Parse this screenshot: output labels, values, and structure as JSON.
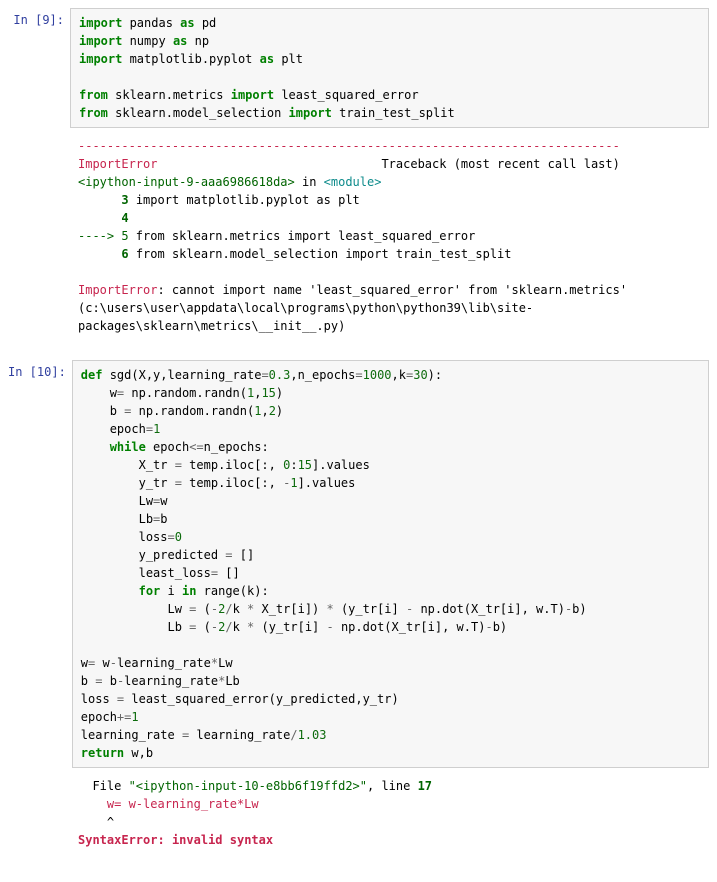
{
  "cells": [
    {
      "prompt": "In [9]:",
      "input_lines": [
        [
          {
            "cls": "kw",
            "t": "import"
          },
          {
            "cls": "nm",
            "t": " pandas "
          },
          {
            "cls": "kw",
            "t": "as"
          },
          {
            "cls": "nm",
            "t": " pd"
          }
        ],
        [
          {
            "cls": "kw",
            "t": "import"
          },
          {
            "cls": "nm",
            "t": " numpy "
          },
          {
            "cls": "kw",
            "t": "as"
          },
          {
            "cls": "nm",
            "t": " np"
          }
        ],
        [
          {
            "cls": "kw",
            "t": "import"
          },
          {
            "cls": "nm",
            "t": " matplotlib.pyplot "
          },
          {
            "cls": "kw",
            "t": "as"
          },
          {
            "cls": "nm",
            "t": " plt"
          }
        ],
        [],
        [
          {
            "cls": "kw",
            "t": "from"
          },
          {
            "cls": "nm",
            "t": " sklearn.metrics "
          },
          {
            "cls": "kw",
            "t": "import"
          },
          {
            "cls": "nm",
            "t": " least_squared_error"
          }
        ],
        [
          {
            "cls": "kw",
            "t": "from"
          },
          {
            "cls": "nm",
            "t": " sklearn.model_selection "
          },
          {
            "cls": "kw",
            "t": "import"
          },
          {
            "cls": "nm",
            "t": " train_test_split"
          }
        ]
      ],
      "output_lines": [
        [
          {
            "cls": "err-red",
            "t": "---------------------------------------------------------------------------"
          }
        ],
        [
          {
            "cls": "err-red",
            "t": "ImportError"
          },
          {
            "cls": "nm",
            "t": "                               Traceback (most recent call last)"
          }
        ],
        [
          {
            "cls": "err-green",
            "t": "<ipython-input-9-aaa6986618da>"
          },
          {
            "cls": "nm",
            "t": " in "
          },
          {
            "cls": "err-cyan",
            "t": "<module>"
          }
        ],
        [
          {
            "cls": "nm",
            "t": "      "
          },
          {
            "cls": "err-green bold",
            "t": "3"
          },
          {
            "cls": "nm",
            "t": " import matplotlib.pyplot as plt"
          }
        ],
        [
          {
            "cls": "nm",
            "t": "      "
          },
          {
            "cls": "err-green bold",
            "t": "4"
          }
        ],
        [
          {
            "cls": "err-green",
            "t": "----> 5"
          },
          {
            "cls": "nm",
            "t": " from sklearn.metrics import least_squared_error"
          }
        ],
        [
          {
            "cls": "nm",
            "t": "      "
          },
          {
            "cls": "err-green bold",
            "t": "6"
          },
          {
            "cls": "nm",
            "t": " from sklearn.model_selection import train_test_split"
          }
        ],
        [],
        [
          {
            "cls": "err-red",
            "t": "ImportError"
          },
          {
            "cls": "nm",
            "t": ": cannot import name 'least_squared_error' from 'sklearn.metrics' (c:\\users\\user\\appdata\\local\\programs\\python\\python39\\lib\\site-packages\\sklearn\\metrics\\__init__.py)"
          }
        ]
      ]
    },
    {
      "prompt": "In [10]:",
      "input_lines": [
        [
          {
            "cls": "kw",
            "t": "def"
          },
          {
            "cls": "nm",
            "t": " sgd(X,y,learning_rate"
          },
          {
            "cls": "op",
            "t": "="
          },
          {
            "cls": "num",
            "t": "0.3"
          },
          {
            "cls": "nm",
            "t": ",n_epochs"
          },
          {
            "cls": "op",
            "t": "="
          },
          {
            "cls": "num",
            "t": "1000"
          },
          {
            "cls": "nm",
            "t": ",k"
          },
          {
            "cls": "op",
            "t": "="
          },
          {
            "cls": "num",
            "t": "30"
          },
          {
            "cls": "nm",
            "t": "):"
          }
        ],
        [
          {
            "cls": "nm",
            "t": "    w"
          },
          {
            "cls": "op",
            "t": "="
          },
          {
            "cls": "nm",
            "t": " np.random.randn("
          },
          {
            "cls": "num",
            "t": "1"
          },
          {
            "cls": "nm",
            "t": ","
          },
          {
            "cls": "num",
            "t": "15"
          },
          {
            "cls": "nm",
            "t": ")"
          }
        ],
        [
          {
            "cls": "nm",
            "t": "    b "
          },
          {
            "cls": "op",
            "t": "="
          },
          {
            "cls": "nm",
            "t": " np.random.randn("
          },
          {
            "cls": "num",
            "t": "1"
          },
          {
            "cls": "nm",
            "t": ","
          },
          {
            "cls": "num",
            "t": "2"
          },
          {
            "cls": "nm",
            "t": ")"
          }
        ],
        [
          {
            "cls": "nm",
            "t": "    epoch"
          },
          {
            "cls": "op",
            "t": "="
          },
          {
            "cls": "num",
            "t": "1"
          }
        ],
        [
          {
            "cls": "nm",
            "t": "    "
          },
          {
            "cls": "kw",
            "t": "while"
          },
          {
            "cls": "nm",
            "t": " epoch"
          },
          {
            "cls": "op",
            "t": "<="
          },
          {
            "cls": "nm",
            "t": "n_epochs:"
          }
        ],
        [
          {
            "cls": "nm",
            "t": "        X_tr "
          },
          {
            "cls": "op",
            "t": "="
          },
          {
            "cls": "nm",
            "t": " temp.iloc[:, "
          },
          {
            "cls": "num",
            "t": "0"
          },
          {
            "cls": "nm",
            "t": ":"
          },
          {
            "cls": "num",
            "t": "15"
          },
          {
            "cls": "nm",
            "t": "].values"
          }
        ],
        [
          {
            "cls": "nm",
            "t": "        y_tr "
          },
          {
            "cls": "op",
            "t": "="
          },
          {
            "cls": "nm",
            "t": " temp.iloc[:, "
          },
          {
            "cls": "op",
            "t": "-"
          },
          {
            "cls": "num",
            "t": "1"
          },
          {
            "cls": "nm",
            "t": "].values"
          }
        ],
        [
          {
            "cls": "nm",
            "t": "        Lw"
          },
          {
            "cls": "op",
            "t": "="
          },
          {
            "cls": "nm",
            "t": "w"
          }
        ],
        [
          {
            "cls": "nm",
            "t": "        Lb"
          },
          {
            "cls": "op",
            "t": "="
          },
          {
            "cls": "nm",
            "t": "b"
          }
        ],
        [
          {
            "cls": "nm",
            "t": "        loss"
          },
          {
            "cls": "op",
            "t": "="
          },
          {
            "cls": "num",
            "t": "0"
          }
        ],
        [
          {
            "cls": "nm",
            "t": "        y_predicted "
          },
          {
            "cls": "op",
            "t": "="
          },
          {
            "cls": "nm",
            "t": " []"
          }
        ],
        [
          {
            "cls": "nm",
            "t": "        least_loss"
          },
          {
            "cls": "op",
            "t": "="
          },
          {
            "cls": "nm",
            "t": " []"
          }
        ],
        [
          {
            "cls": "nm",
            "t": "        "
          },
          {
            "cls": "kw",
            "t": "for"
          },
          {
            "cls": "nm",
            "t": " i "
          },
          {
            "cls": "kw",
            "t": "in"
          },
          {
            "cls": "nm",
            "t": " range(k):"
          }
        ],
        [
          {
            "cls": "nm",
            "t": "            Lw "
          },
          {
            "cls": "op",
            "t": "="
          },
          {
            "cls": "nm",
            "t": " ("
          },
          {
            "cls": "op",
            "t": "-"
          },
          {
            "cls": "num",
            "t": "2"
          },
          {
            "cls": "op",
            "t": "/"
          },
          {
            "cls": "nm",
            "t": "k "
          },
          {
            "cls": "op",
            "t": "*"
          },
          {
            "cls": "nm",
            "t": " X_tr[i]) "
          },
          {
            "cls": "op",
            "t": "*"
          },
          {
            "cls": "nm",
            "t": " (y_tr[i] "
          },
          {
            "cls": "op",
            "t": "-"
          },
          {
            "cls": "nm",
            "t": " np.dot(X_tr[i], w.T)"
          },
          {
            "cls": "op",
            "t": "-"
          },
          {
            "cls": "nm",
            "t": "b)"
          }
        ],
        [
          {
            "cls": "nm",
            "t": "            Lb "
          },
          {
            "cls": "op",
            "t": "="
          },
          {
            "cls": "nm",
            "t": " ("
          },
          {
            "cls": "op",
            "t": "-"
          },
          {
            "cls": "num",
            "t": "2"
          },
          {
            "cls": "op",
            "t": "/"
          },
          {
            "cls": "nm",
            "t": "k "
          },
          {
            "cls": "op",
            "t": "*"
          },
          {
            "cls": "nm",
            "t": " (y_tr[i] "
          },
          {
            "cls": "op",
            "t": "-"
          },
          {
            "cls": "nm",
            "t": " np.dot(X_tr[i], w.T)"
          },
          {
            "cls": "op",
            "t": "-"
          },
          {
            "cls": "nm",
            "t": "b)"
          }
        ],
        [],
        [
          {
            "cls": "nm",
            "t": "w"
          },
          {
            "cls": "op",
            "t": "="
          },
          {
            "cls": "nm",
            "t": " w"
          },
          {
            "cls": "op",
            "t": "-"
          },
          {
            "cls": "nm",
            "t": "learning_rate"
          },
          {
            "cls": "op",
            "t": "*"
          },
          {
            "cls": "nm",
            "t": "Lw"
          }
        ],
        [
          {
            "cls": "nm",
            "t": "b "
          },
          {
            "cls": "op",
            "t": "="
          },
          {
            "cls": "nm",
            "t": " b"
          },
          {
            "cls": "op",
            "t": "-"
          },
          {
            "cls": "nm",
            "t": "learning_rate"
          },
          {
            "cls": "op",
            "t": "*"
          },
          {
            "cls": "nm",
            "t": "Lb"
          }
        ],
        [
          {
            "cls": "nm",
            "t": "loss "
          },
          {
            "cls": "op",
            "t": "="
          },
          {
            "cls": "nm",
            "t": " least_squared_error(y_predicted,y_tr)"
          }
        ],
        [
          {
            "cls": "nm",
            "t": "epoch"
          },
          {
            "cls": "op",
            "t": "+="
          },
          {
            "cls": "num",
            "t": "1"
          }
        ],
        [
          {
            "cls": "nm",
            "t": "learning_rate "
          },
          {
            "cls": "op",
            "t": "="
          },
          {
            "cls": "nm",
            "t": " learning_rate"
          },
          {
            "cls": "op",
            "t": "/"
          },
          {
            "cls": "num",
            "t": "1.03"
          }
        ],
        [
          {
            "cls": "kw",
            "t": "return"
          },
          {
            "cls": "nm",
            "t": " w,b"
          }
        ]
      ],
      "output_lines": [
        [
          {
            "cls": "nm",
            "t": "  File "
          },
          {
            "cls": "err-green",
            "t": "\"<ipython-input-10-e8bb6f19ffd2>\""
          },
          {
            "cls": "nm",
            "t": ", line "
          },
          {
            "cls": "err-green bold",
            "t": "17"
          }
        ],
        [
          {
            "cls": "err-red",
            "t": "    w= w-learning_rate*Lw"
          }
        ],
        [
          {
            "cls": "nm",
            "t": "    ^"
          }
        ],
        [
          {
            "cls": "err-red bold",
            "t": "SyntaxError"
          },
          {
            "cls": "err-red bold",
            "t": ":"
          },
          {
            "cls": "nm",
            "t": " "
          },
          {
            "cls": "err-red bold",
            "t": "invalid syntax"
          }
        ]
      ]
    }
  ]
}
